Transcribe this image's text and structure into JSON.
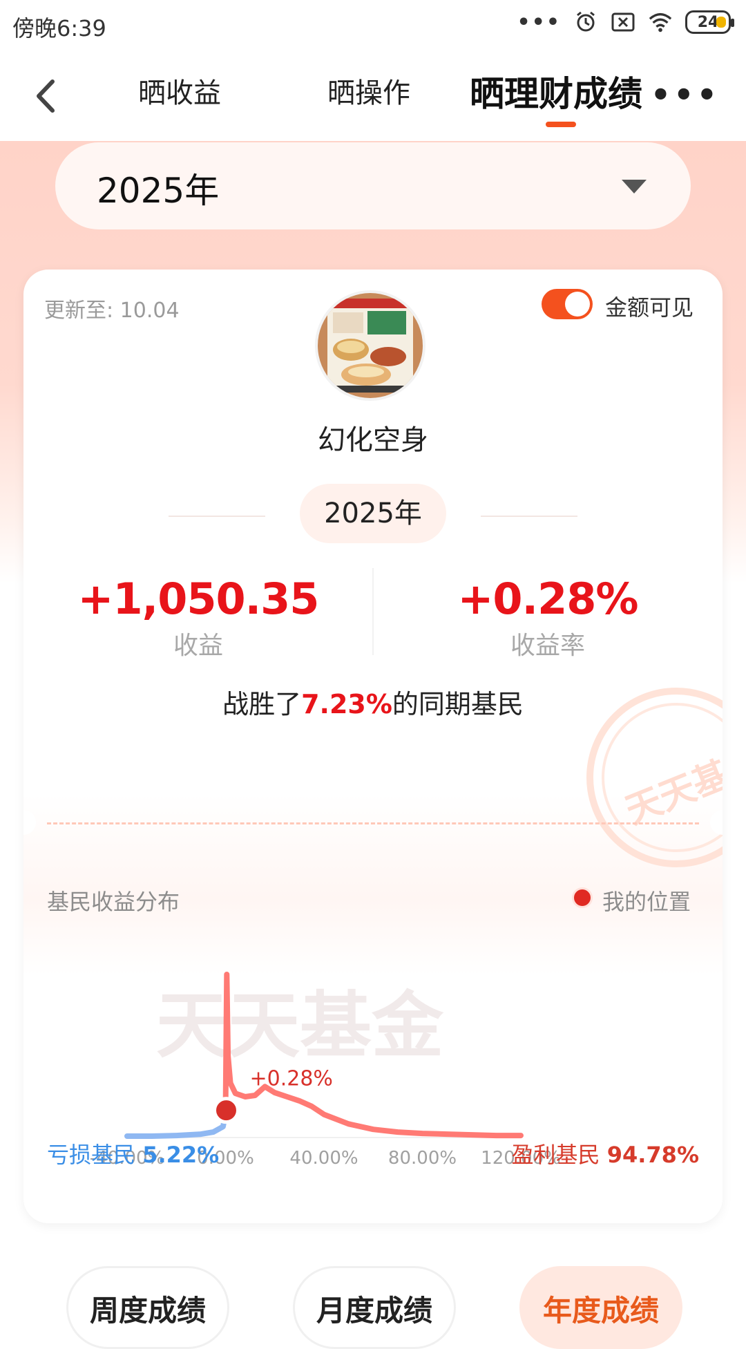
{
  "status_bar": {
    "time": "傍晚6:39",
    "battery": "24"
  },
  "nav": {
    "tabs": [
      "晒收益",
      "晒操作",
      "晒理财成绩"
    ],
    "active_tab": "晒理财成绩"
  },
  "year_select": {
    "value": "2025年"
  },
  "card": {
    "update_label": "更新至: 10.04",
    "toggle_label": "金额可见",
    "toggle_on": true,
    "nickname": "幻化空身",
    "year": "2025年",
    "profit_value": "+1,050.35",
    "profit_label": "收益",
    "rate_value": "+0.28%",
    "rate_label": "收益率",
    "beat_prefix": "战胜了",
    "beat_value": "7.23%",
    "beat_suffix": "的同期基民",
    "stamp_text": "天天基金"
  },
  "distribution": {
    "title": "基民收益分布",
    "legend": "我的位置",
    "watermark": "天天基金",
    "loss_label": "亏损基民",
    "loss_value": "5.22%",
    "gain_label": "盈利基民",
    "gain_value": "94.78%"
  },
  "bottom_tabs": [
    "周度成绩",
    "月度成绩",
    "年度成绩"
  ],
  "bottom_active": "年度成绩",
  "colors": {
    "accent": "#f4511e",
    "profit": "#e8141a",
    "loss": "#3a8ee6",
    "gain_line": "#ff7a74"
  },
  "chart_data": {
    "type": "area",
    "x_unit": "%",
    "xlim": [
      -40,
      120
    ],
    "x_ticks": [
      "-40.00%",
      "0.00%",
      "40.00%",
      "80.00%",
      "120.00%"
    ],
    "x_tick_values": [
      -40,
      0,
      40,
      80,
      120
    ],
    "series": [
      {
        "x": [
          -40,
          -30,
          -20,
          -10,
          -5,
          -1,
          0,
          0.5,
          1,
          2,
          4,
          8,
          12,
          16,
          20,
          25,
          30,
          35,
          40,
          50,
          60,
          70,
          80,
          90,
          100,
          110,
          120
        ],
        "y": [
          0.2,
          0.2,
          0.3,
          0.5,
          0.8,
          1.6,
          3.5,
          24,
          12,
          8,
          6.5,
          6.0,
          6.2,
          7.5,
          6.6,
          6.0,
          5.4,
          4.6,
          3.4,
          2.0,
          1.2,
          0.8,
          0.6,
          0.5,
          0.4,
          0.3,
          0.3
        ]
      }
    ],
    "marker": {
      "x": 0.28,
      "y": 4,
      "label": "+0.28%"
    }
  }
}
